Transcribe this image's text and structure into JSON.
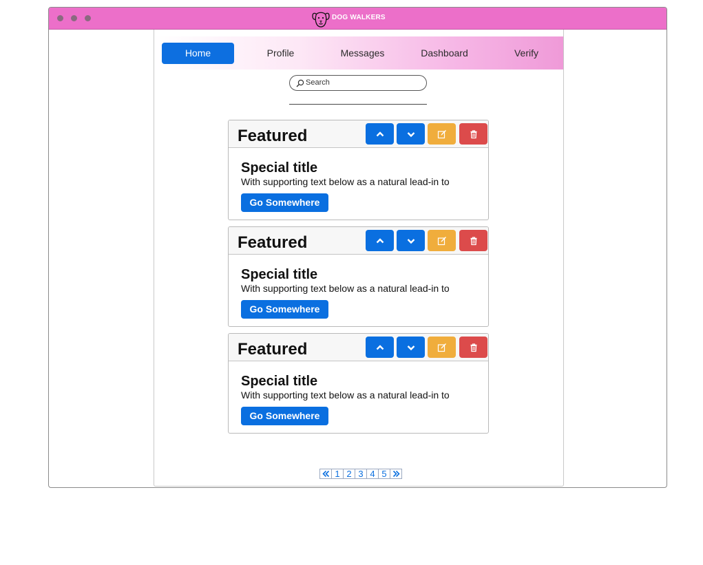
{
  "app": {
    "title": "DOG WALKERS",
    "logo_icon": "dog-face-icon",
    "window_controls": [
      "window-dot-icon",
      "window-dot-icon",
      "window-dot-icon"
    ]
  },
  "nav": {
    "items": [
      {
        "label": "Home",
        "active": true
      },
      {
        "label": "Profile",
        "active": false
      },
      {
        "label": "Messages",
        "active": false
      },
      {
        "label": "Dashboard",
        "active": false
      },
      {
        "label": "Verify",
        "active": false
      }
    ]
  },
  "search": {
    "placeholder": "Search",
    "icon": "search-icon"
  },
  "cards": [
    {
      "header": "Featured",
      "title": "Special title",
      "text": "With supporting text below as a natural lead-in to",
      "button": "Go Somewhere",
      "controls": [
        "chevron-up-icon",
        "chevron-down-icon",
        "edit-icon",
        "trash-icon"
      ]
    },
    {
      "header": "Featured",
      "title": "Special title",
      "text": "With supporting text below as a natural lead-in to",
      "button": "Go Somewhere",
      "controls": [
        "chevron-up-icon",
        "chevron-down-icon",
        "edit-icon",
        "trash-icon"
      ]
    },
    {
      "header": "Featured",
      "title": "Special title",
      "text": "With supporting text below as a natural lead-in to",
      "button": "Go Somewhere",
      "controls": [
        "chevron-up-icon",
        "chevron-down-icon",
        "edit-icon",
        "trash-icon"
      ]
    }
  ],
  "pagination": {
    "prev_icon": "double-chevron-left-icon",
    "pages": [
      "1",
      "2",
      "3",
      "4",
      "5"
    ],
    "next_icon": "double-chevron-right-icon"
  },
  "colors": {
    "titlebar": "#ec6fc9",
    "primary": "#0a6fe0",
    "warning": "#f0ad3c",
    "danger": "#dc4b4b"
  }
}
